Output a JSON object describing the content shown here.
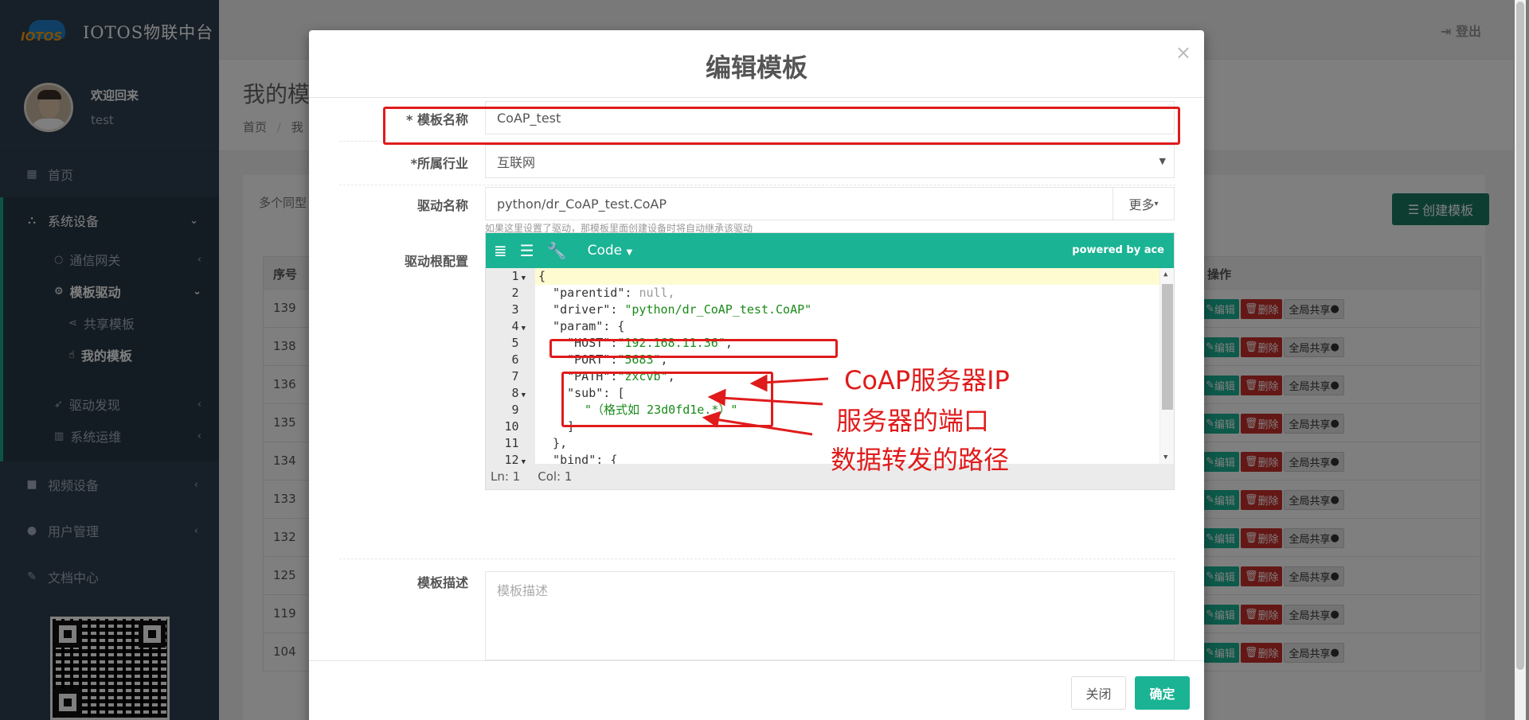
{
  "brand": {
    "logo_text": "IOTOS",
    "title": "IOTOS物联中台"
  },
  "profile": {
    "welcome": "欢迎回来",
    "username": "test"
  },
  "nav": {
    "home": "首页",
    "system_devices": "系统设备",
    "gateway": "通信网关",
    "template_driver": "模板驱动",
    "shared_templates": "共享模板",
    "my_templates": "我的模板",
    "driver_discovery": "驱动发现",
    "system_ops": "系统运维",
    "video_devices": "视频设备",
    "user_management": "用户管理",
    "doc_center": "文档中心"
  },
  "topbar": {
    "logout": "登出"
  },
  "page": {
    "title_partial": "我的模",
    "breadcrumb_home": "首页",
    "breadcrumb_sep": "/",
    "breadcrumb_cur": "我"
  },
  "panel": {
    "hint": "多个同型",
    "create_button": "创建模板"
  },
  "table": {
    "col_id": "序号",
    "col_ops": "操作",
    "rows": [
      "139",
      "138",
      "136",
      "135",
      "134",
      "133",
      "132",
      "125",
      "119",
      "104"
    ],
    "edit_label": "编辑",
    "delete_label": "删除",
    "share_label": "全局共享"
  },
  "modal": {
    "title": "编辑模板",
    "close_symbol": "×",
    "fields": {
      "name_label": "* 模板名称",
      "name_value": "CoAP_test",
      "industry_label": "*所属行业",
      "industry_value": "互联网",
      "driver_label": "驱动名称",
      "driver_value": "python/dr_CoAP_test.CoAP",
      "more_button": "更多",
      "driver_help": "如果这里设置了驱动，那模板里面创建设备时将自动继承该驱动",
      "config_label": "驱动根配置",
      "desc_label": "模板描述",
      "desc_placeholder": "模板描述"
    },
    "editor": {
      "mode": "Code",
      "powered_by": "powered by ace",
      "status_ln": "Ln: 1",
      "status_col": "Col: 1",
      "line_numbers": [
        "1",
        "2",
        "3",
        "4",
        "5",
        "6",
        "7",
        "8",
        "9",
        "10",
        "11",
        "12"
      ],
      "lines": {
        "l1": "{",
        "l2_key": "  \"parentid\"",
        "l2_val": "null,",
        "l3_key": "  \"driver\"",
        "l3_val": "\"python/dr_CoAP_test.CoAP\"",
        "l4_key": "  \"param\"",
        "l4_val": "{",
        "l5_key": "    \"HOST\"",
        "l5_val": "\"192.168.11.36\"",
        "l6_key": "    \"PORT\"",
        "l6_val": "\"5683\"",
        "l7_key": "    \"PATH\"",
        "l7_val": "\"zxcvb\"",
        "l8_key": "    \"sub\"",
        "l8_val": "[",
        "l9": "\"（格式如 23d0fd1e.*）\"",
        "l10": "    ]",
        "l11": "  },",
        "l12_key": "  \"bind\"",
        "l12_val": "{"
      }
    },
    "close_button": "关闭",
    "ok_button": "确定"
  },
  "annotations": {
    "host": "CoAP服务器IP",
    "port": "服务器的端口",
    "path": "数据转发的路径"
  },
  "colors": {
    "accent": "#1ab394",
    "sidebar": "#2f4050",
    "annotation": "#e01b1b"
  }
}
